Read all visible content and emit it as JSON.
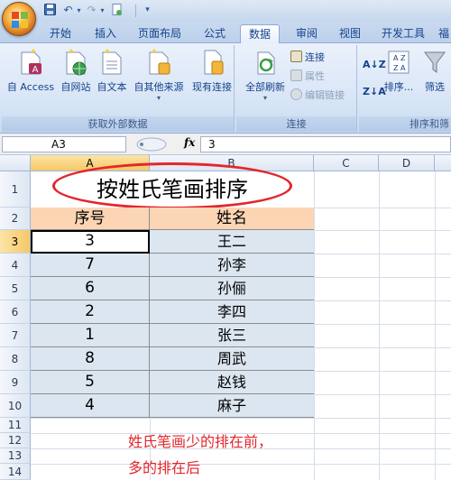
{
  "qat": {
    "icons": [
      "save-icon",
      "undo-icon",
      "redo-icon",
      "new-icon",
      "customize-icon"
    ]
  },
  "tabs": [
    {
      "label": "开始"
    },
    {
      "label": "插入"
    },
    {
      "label": "页面布局"
    },
    {
      "label": "公式"
    },
    {
      "label": "数据",
      "active": true
    },
    {
      "label": "审阅"
    },
    {
      "label": "视图"
    },
    {
      "label": "开发工具"
    },
    {
      "label": "福"
    }
  ],
  "ribbon": {
    "external": {
      "label": "获取外部数据",
      "access": "自 Access",
      "web": "自网站",
      "text": "自文本",
      "other": "自其他来源",
      "existing": "现有连接"
    },
    "connections": {
      "label": "连接",
      "refresh_all": "全部刷新",
      "connections": "连接",
      "properties": "属性",
      "edit_links": "编辑链接"
    },
    "sort": {
      "label": "排序和筛",
      "sort": "排序...",
      "filter": "筛选"
    }
  },
  "formula_bar": {
    "name_box": "A3",
    "fx_label": "fx",
    "value": "3"
  },
  "sheet": {
    "columns": [
      "A",
      "B",
      "C",
      "D"
    ],
    "rows": [
      "1",
      "2",
      "3",
      "4",
      "5",
      "6",
      "7",
      "8",
      "9",
      "10",
      "11",
      "12",
      "13",
      "14"
    ],
    "title": "按姓氏笔画排序",
    "headers": [
      "序号",
      "姓名"
    ],
    "data": [
      [
        "3",
        "王二"
      ],
      [
        "7",
        "孙李"
      ],
      [
        "6",
        "孙俪"
      ],
      [
        "2",
        "李四"
      ],
      [
        "1",
        "张三"
      ],
      [
        "8",
        "周武"
      ],
      [
        "5",
        "赵钱"
      ],
      [
        "4",
        "麻子"
      ]
    ],
    "note_line1": "姓氏笔画少的排在前，",
    "note_line2": "多的排在后"
  },
  "colors": {
    "annotation": "#e3262c",
    "header_fill": "#fcd5b4",
    "data_fill": "#dce6f1",
    "ribbon": "#dbe7f7"
  }
}
